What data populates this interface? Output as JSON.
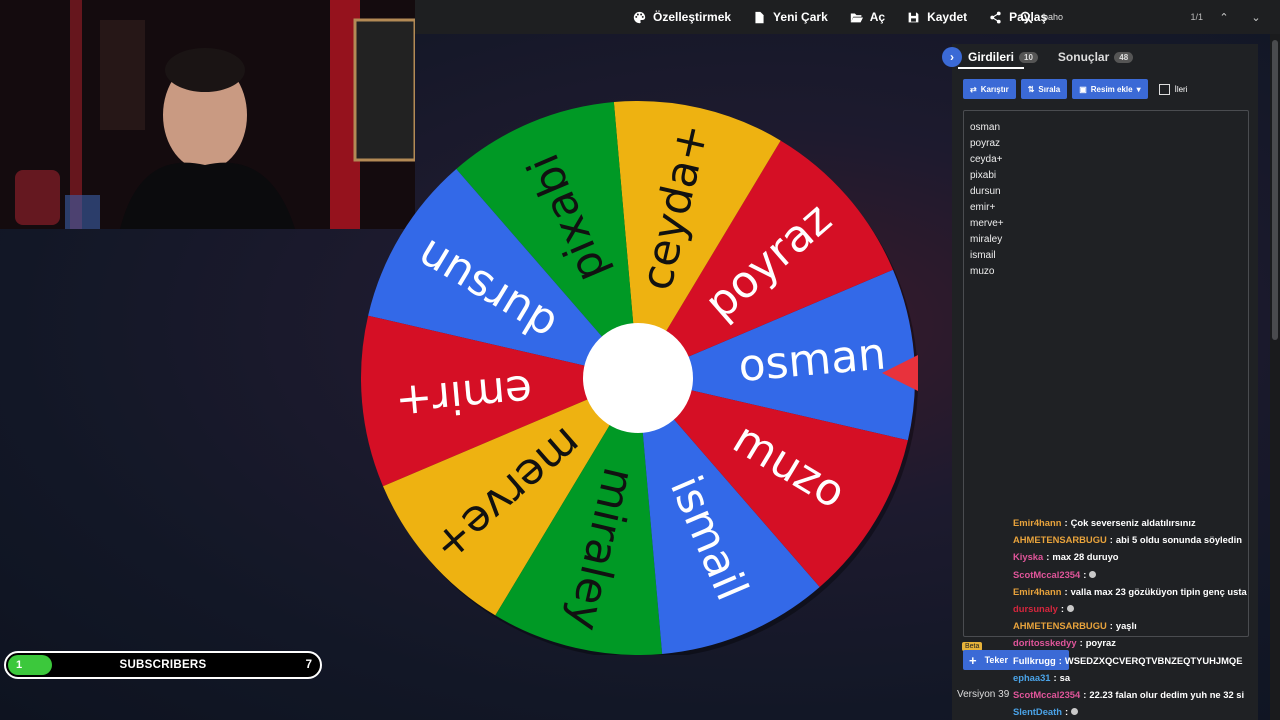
{
  "toolbar": {
    "items": [
      {
        "label": "Özelleştirmek",
        "icon": "palette-icon"
      },
      {
        "label": "Yeni Çark",
        "icon": "file-icon"
      },
      {
        "label": "Aç",
        "icon": "folder-open-icon"
      },
      {
        "label": "Kaydet",
        "icon": "save-icon"
      },
      {
        "label": "Paylaş",
        "icon": "share-icon"
      }
    ]
  },
  "find_bar": {
    "query": "baho",
    "count": "1/1"
  },
  "wheel": {
    "segments": [
      {
        "label": "osman",
        "color": "#3369e8"
      },
      {
        "label": "poyraz",
        "color": "#d50f25"
      },
      {
        "label": "ceyda+",
        "color": "#eeb211"
      },
      {
        "label": "pixabi",
        "color": "#009925"
      },
      {
        "label": "dursun",
        "color": "#3369e8"
      },
      {
        "label": "emir+",
        "color": "#d50f25"
      },
      {
        "label": "merve+",
        "color": "#eeb211"
      },
      {
        "label": "miraley",
        "color": "#009925"
      },
      {
        "label": "ismail",
        "color": "#3369e8"
      },
      {
        "label": "muzo",
        "color": "#d50f25"
      }
    ],
    "pointer_color": "#e8323c"
  },
  "panel": {
    "tab_entries": "Girdileri",
    "entries_count": "10",
    "tab_results": "Sonuçlar",
    "results_count": "48",
    "shuffle_label": "Karıştır",
    "sort_label": "Sırala",
    "add_image_label": "Resim ekle",
    "advanced_label": "İleri",
    "entries": [
      "osman",
      "poyraz",
      "ceyda+",
      "pixabi",
      "dursun",
      "emir+",
      "merve+",
      "miraley",
      "ismail",
      "muzo"
    ],
    "beta_label": "Beta",
    "add_wheel_label": "Teker",
    "version_label": "Versiyon 39"
  },
  "chat": [
    {
      "user": "Emir4hann",
      "color": "#e8a33c",
      "text": "Çok severseniz aldatılırsınız"
    },
    {
      "user": "AHMETENSARBUGU",
      "color": "#e8a33c",
      "text": "abi 5 oldu sonunda söyledin"
    },
    {
      "user": "Kiyska",
      "color": "#e0559a",
      "text": "max 28 duruyo"
    },
    {
      "user": "ScotMccal2354",
      "color": "#e0559a",
      "text": "",
      "icon": true
    },
    {
      "user": "Emir4hann",
      "color": "#e8a33c",
      "text": "valla max 23 gözüküyon tipin genç usta"
    },
    {
      "user": "dursunaly",
      "color": "#d5263d",
      "text": "",
      "icon": true
    },
    {
      "user": "AHMETENSARBUGU",
      "color": "#e8a33c",
      "text": "yaşlı"
    },
    {
      "user": "doritosskedyy",
      "color": "#e0559a",
      "text": "poyraz"
    },
    {
      "user": "Fullkrugg",
      "color": "#ffffff",
      "text": "WSEDZXQCVERQTVBNZEQTYUHJMQE"
    },
    {
      "user": "ephaa31",
      "color": "#4aa3e8",
      "text": "sa"
    },
    {
      "user": "ScotMccal2354",
      "color": "#e0559a",
      "text": "22.23 falan olur dedim yuh ne 32 si"
    },
    {
      "user": "SlentDeath",
      "color": "#4aa3e8",
      "text": "",
      "icon": true
    }
  ],
  "subscribers": {
    "label": "SUBSCRIBERS",
    "current": "1",
    "goal": "7",
    "progress": 0.14,
    "fill_color": "#3cc83c"
  }
}
